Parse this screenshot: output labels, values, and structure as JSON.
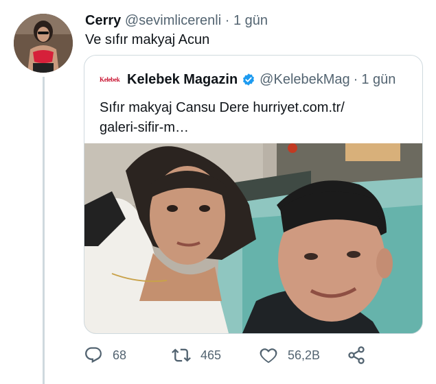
{
  "tweet": {
    "display_name": "Cerry",
    "handle": "@sevimlicerenli",
    "separator": "·",
    "time": "1 gün",
    "text": "Ve sıfır makyaj Acun"
  },
  "quoted": {
    "logo_text": "Kelebek",
    "display_name": "Kelebek Magazin",
    "verified": true,
    "handle": "@KelebekMag",
    "separator": "·",
    "time": "1 gün",
    "text_line1": "Sıfır makyaj Cansu Dere hurriyet.com.tr/",
    "text_line2": "galeri-sifir-m…"
  },
  "actions": {
    "reply_count": "68",
    "retweet_count": "465",
    "like_count": "56,2B"
  },
  "icons": {
    "reply": "reply-icon",
    "retweet": "retweet-icon",
    "like": "heart-icon",
    "share": "share-icon",
    "verified": "verified-badge-icon"
  },
  "colors": {
    "text": "#0f1419",
    "secondary": "#536471",
    "border": "#cfd9de",
    "verified": "#1d9bf0",
    "logo": "#c8102e"
  }
}
